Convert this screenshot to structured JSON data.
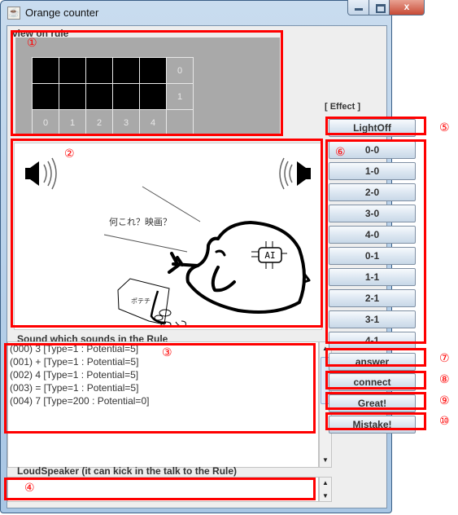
{
  "window": {
    "title": "Orange counter",
    "icon": "java-coffee-icon",
    "controls": {
      "minimize": "minimize-icon",
      "maximize": "maximize-icon",
      "close": "x"
    }
  },
  "rule_view": {
    "label": "view on rule",
    "grid": {
      "rows": [
        {
          "cells": [
            true,
            true,
            true,
            true,
            true
          ],
          "row_label": "0"
        },
        {
          "cells": [
            true,
            true,
            true,
            true,
            true
          ],
          "row_label": "1"
        }
      ],
      "column_labels": [
        "0",
        "1",
        "2",
        "3",
        "4"
      ]
    }
  },
  "illustration": {
    "speech_text": "何これ？映画？",
    "chip_text": "AI",
    "bag_text": "ポテチ",
    "left_speaker": "speaker-left-icon",
    "right_speaker": "speaker-right-icon"
  },
  "sound_list": {
    "label": "Sound which sounds in the Rule",
    "items": [
      "(000) 3 [Type=1 : Potential=5]",
      "(001) + [Type=1 : Potential=5]",
      "(002) 4 [Type=1 : Potential=5]",
      "(003) = [Type=1 : Potential=5]",
      "(004) 7 [Type=200 : Potential=0]"
    ]
  },
  "loudspeaker": {
    "label": "LoudSpeaker (it can kick in the talk to the Rule)",
    "value": ""
  },
  "effect": {
    "label": "[ Effect ]",
    "lightoff": "LightOff",
    "cell_buttons": [
      "0-0",
      "1-0",
      "2-0",
      "3-0",
      "4-0",
      "0-1",
      "1-1",
      "2-1",
      "3-1",
      "4-1"
    ],
    "answer": "answer",
    "connect": "connect",
    "great": "Great!",
    "mistake": "Mistake!"
  },
  "annotations": {
    "n1": "①",
    "n2": "②",
    "n3": "③",
    "n4": "④",
    "n5": "⑤",
    "n6": "⑥",
    "n7": "⑦",
    "n8": "⑧",
    "n9": "⑨",
    "n10": "⑩"
  },
  "colors": {
    "annotation": "#ff0000",
    "panel_gray": "#a9a9a9",
    "light_on": "#000000"
  }
}
